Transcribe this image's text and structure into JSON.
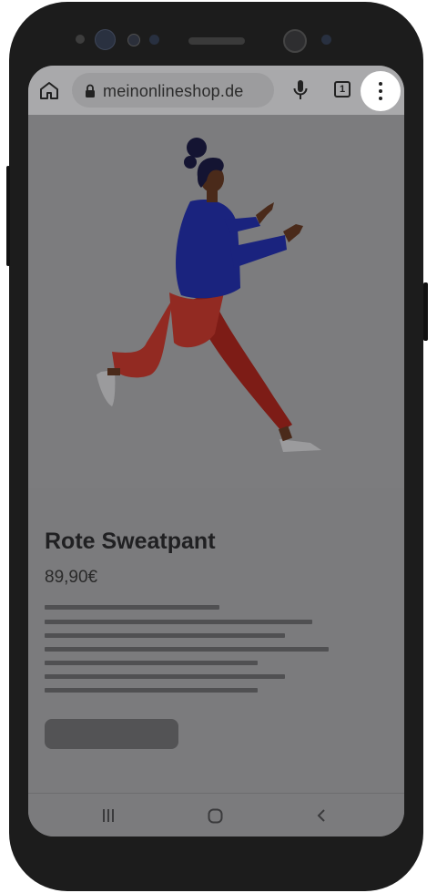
{
  "browser": {
    "url": "meinonlineshop.de",
    "open_tabs_count": "1",
    "icons": [
      "home-icon",
      "lock-icon",
      "microphone-icon",
      "tabs-icon",
      "more-menu-icon"
    ]
  },
  "product": {
    "title": "Rote Sweatpant",
    "price": "89,90€",
    "description_placeholder_lines": 7
  },
  "navigation_bar": {
    "icons": [
      "recent-apps-icon",
      "home-circle-icon",
      "back-icon"
    ]
  },
  "colors": {
    "overlay_gray": "#7b7b7d",
    "menu_highlight": "#ffffff",
    "pants_red": "#8f2820",
    "sweater_blue": "#1a237e"
  }
}
